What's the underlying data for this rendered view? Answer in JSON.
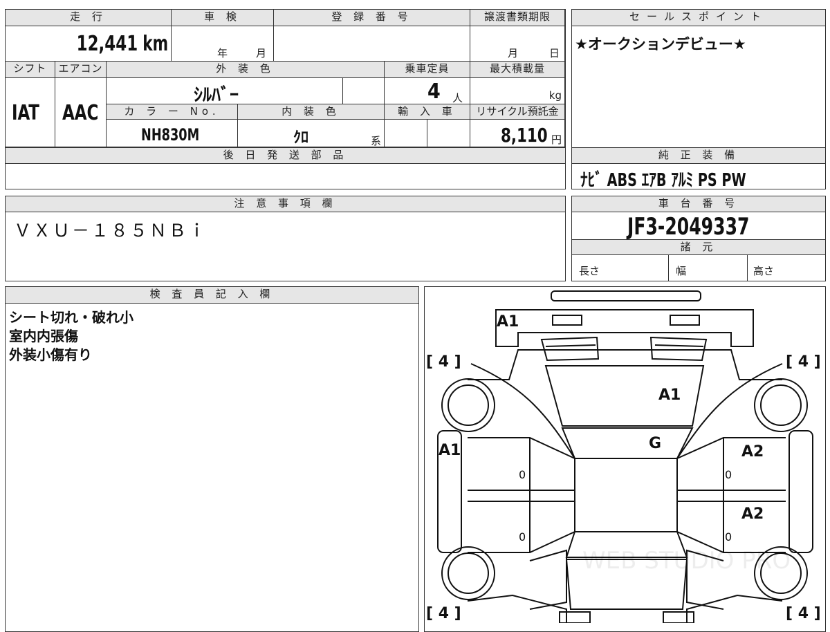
{
  "top_form": {
    "mileage_label": "走 行",
    "mileage_value": "12,441",
    "mileage_unit": "km",
    "shaken_label": "車 検",
    "shaken_year": "年",
    "shaken_month": "月",
    "reg_no_label": "登 録 番 号",
    "transfer_label": "譲渡書類期限",
    "transfer_month": "月",
    "transfer_day": "日",
    "shift_label": "シフト",
    "shift_value": "IAT",
    "aircon_label": "エアコン",
    "aircon_value": "AAC",
    "ext_color_label": "外 装 色",
    "ext_color_value": "ｼﾙﾊﾞｰ",
    "capacity_label": "乗車定員",
    "capacity_value": "4",
    "capacity_unit": "人",
    "max_load_label": "最大積載量",
    "max_load_unit": "kg",
    "color_no_label": "カ ラ ー No.",
    "color_no_value": "NH830M",
    "int_color_label": "内 装 色",
    "int_color_value": "ｸﾛ",
    "int_color_suffix": "系",
    "import_label": "輸 入 車",
    "recycle_label": "リサイクル預託金",
    "recycle_value": "8,110",
    "recycle_unit": "円",
    "later_parts_label": "後 日 発 送 部 品"
  },
  "sales_point": {
    "label": "セールスポイント",
    "text": "★オークションデビュー★"
  },
  "equipment": {
    "label": "純 正 装 備",
    "text": "ﾅﾋﾞ ABS ｴｱB ｱﾙﾐ PS PW"
  },
  "notes": {
    "label": "注 意 事 項 欄",
    "text": "ＶＸＵ－１８５ＮＢｉ"
  },
  "chassis": {
    "label": "車 台 番 号",
    "value": "JF3-2049337",
    "spec_label": "諸 元",
    "length_label": "長さ",
    "width_label": "幅",
    "height_label": "高さ"
  },
  "inspector": {
    "label": "検 査 員 記 入 欄",
    "lines": [
      "シート切れ・破れ小",
      "室内内張傷",
      "外装小傷有り"
    ]
  },
  "diagram": {
    "tire_marks": [
      "[ 4 ]",
      "[ 4 ]",
      "[ 4 ]",
      "[ 4 ]"
    ],
    "damage_codes": {
      "front_bumper": "A1",
      "hood": "A1",
      "windshield": "G",
      "left_front_fender": "A1",
      "right_front_door": "A2",
      "right_rear_door": "A2"
    },
    "door_zeros": [
      "0",
      "0",
      "0",
      "0"
    ],
    "watermark": "WEB STUDIO PRO"
  }
}
